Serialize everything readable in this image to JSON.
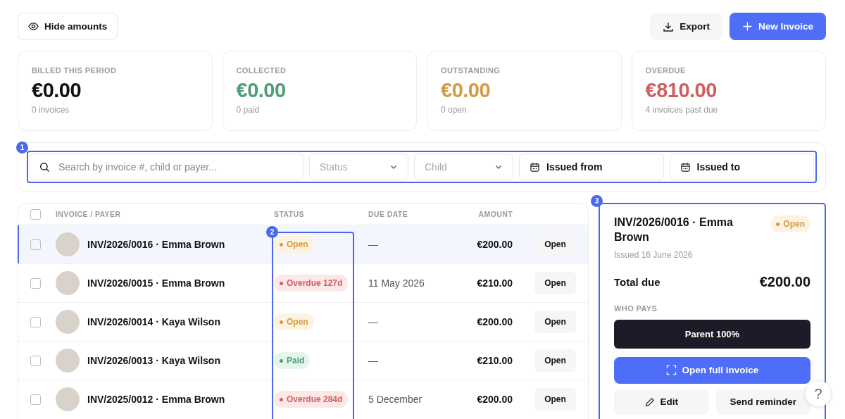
{
  "toolbar": {
    "hide_amounts": "Hide amounts",
    "export": "Export",
    "new_invoice": "New Invoice"
  },
  "summary": [
    {
      "label": "BILLED THIS PERIOD",
      "amount": "€0.00",
      "note": "0 invoices",
      "kind": "neutral"
    },
    {
      "label": "COLLECTED",
      "amount": "€0.00",
      "note": "0 paid",
      "kind": "positive"
    },
    {
      "label": "OUTSTANDING",
      "amount": "€0.00",
      "note": "0 open",
      "kind": "warning"
    },
    {
      "label": "OVERDUE",
      "amount": "€810.00",
      "note": "4 invoices past due",
      "kind": "danger"
    }
  ],
  "filters": {
    "annotation": "1",
    "search": {
      "placeholder": "Search by invoice #, child or payer..."
    },
    "status": {
      "placeholder": "Status"
    },
    "child": {
      "placeholder": "Child"
    },
    "issued_from": "Issued from",
    "issued_to": "Issued to"
  },
  "table": {
    "select_all_checked": false,
    "columns": [
      "INVOICE / PAYER",
      "STATUS",
      "DUE DATE",
      "AMOUNT"
    ],
    "status_annotation": "2",
    "rows": [
      {
        "invoice": "INV/2026/0016 · Emma Brown",
        "status": {
          "label": "Open",
          "kind": "open"
        },
        "due": "—",
        "amount": "€200.00",
        "action": "Open",
        "selected": true,
        "checked": false
      },
      {
        "invoice": "INV/2026/0015 · Emma Brown",
        "status": {
          "label": "Overdue 127d",
          "kind": "overdue"
        },
        "due": "11 May 2026",
        "amount": "€210.00",
        "action": "Open",
        "selected": false,
        "checked": false
      },
      {
        "invoice": "INV/2026/0014 · Kaya Wilson",
        "status": {
          "label": "Open",
          "kind": "open"
        },
        "due": "—",
        "amount": "€200.00",
        "action": "Open",
        "selected": false,
        "checked": false
      },
      {
        "invoice": "INV/2026/0013 · Kaya Wilson",
        "status": {
          "label": "Paid",
          "kind": "paid"
        },
        "due": "—",
        "amount": "€210.00",
        "action": "Open",
        "selected": false,
        "checked": false
      },
      {
        "invoice": "INV/2025/0012 · Emma Brown",
        "status": {
          "label": "Overdue 284d",
          "kind": "overdue"
        },
        "due": "5 December",
        "amount": "€200.00",
        "action": "Open",
        "selected": false,
        "checked": false
      }
    ]
  },
  "detail": {
    "annotation": "3",
    "title": "INV/2026/0016 · Emma Brown",
    "status": {
      "label": "Open",
      "kind": "open"
    },
    "issued": "Issued 16 June 2026",
    "total_label": "Total due",
    "total": "€200.00",
    "who_pays_label": "WHO PAYS",
    "payer": "Parent 100%",
    "open_full": "Open full invoice",
    "edit": "Edit",
    "send_reminder": "Send reminder"
  },
  "help": "?"
}
